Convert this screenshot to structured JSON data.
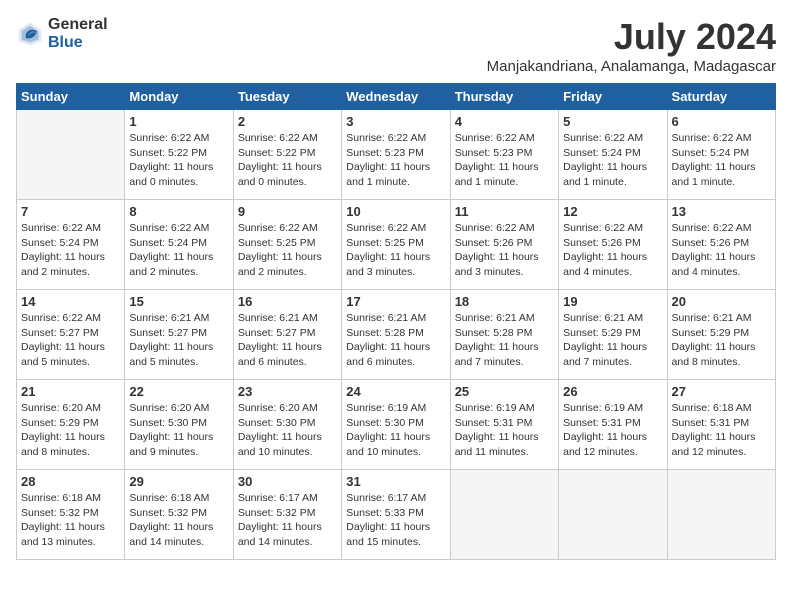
{
  "header": {
    "logo_general": "General",
    "logo_blue": "Blue",
    "month": "July 2024",
    "location": "Manjakandriana, Analamanga, Madagascar"
  },
  "days_of_week": [
    "Sunday",
    "Monday",
    "Tuesday",
    "Wednesday",
    "Thursday",
    "Friday",
    "Saturday"
  ],
  "weeks": [
    [
      {
        "day": "",
        "info": ""
      },
      {
        "day": "1",
        "info": "Sunrise: 6:22 AM\nSunset: 5:22 PM\nDaylight: 11 hours\nand 0 minutes."
      },
      {
        "day": "2",
        "info": "Sunrise: 6:22 AM\nSunset: 5:22 PM\nDaylight: 11 hours\nand 0 minutes."
      },
      {
        "day": "3",
        "info": "Sunrise: 6:22 AM\nSunset: 5:23 PM\nDaylight: 11 hours\nand 1 minute."
      },
      {
        "day": "4",
        "info": "Sunrise: 6:22 AM\nSunset: 5:23 PM\nDaylight: 11 hours\nand 1 minute."
      },
      {
        "day": "5",
        "info": "Sunrise: 6:22 AM\nSunset: 5:24 PM\nDaylight: 11 hours\nand 1 minute."
      },
      {
        "day": "6",
        "info": "Sunrise: 6:22 AM\nSunset: 5:24 PM\nDaylight: 11 hours\nand 1 minute."
      }
    ],
    [
      {
        "day": "7",
        "info": "Sunrise: 6:22 AM\nSunset: 5:24 PM\nDaylight: 11 hours\nand 2 minutes."
      },
      {
        "day": "8",
        "info": "Sunrise: 6:22 AM\nSunset: 5:24 PM\nDaylight: 11 hours\nand 2 minutes."
      },
      {
        "day": "9",
        "info": "Sunrise: 6:22 AM\nSunset: 5:25 PM\nDaylight: 11 hours\nand 2 minutes."
      },
      {
        "day": "10",
        "info": "Sunrise: 6:22 AM\nSunset: 5:25 PM\nDaylight: 11 hours\nand 3 minutes."
      },
      {
        "day": "11",
        "info": "Sunrise: 6:22 AM\nSunset: 5:26 PM\nDaylight: 11 hours\nand 3 minutes."
      },
      {
        "day": "12",
        "info": "Sunrise: 6:22 AM\nSunset: 5:26 PM\nDaylight: 11 hours\nand 4 minutes."
      },
      {
        "day": "13",
        "info": "Sunrise: 6:22 AM\nSunset: 5:26 PM\nDaylight: 11 hours\nand 4 minutes."
      }
    ],
    [
      {
        "day": "14",
        "info": "Sunrise: 6:22 AM\nSunset: 5:27 PM\nDaylight: 11 hours\nand 5 minutes."
      },
      {
        "day": "15",
        "info": "Sunrise: 6:21 AM\nSunset: 5:27 PM\nDaylight: 11 hours\nand 5 minutes."
      },
      {
        "day": "16",
        "info": "Sunrise: 6:21 AM\nSunset: 5:27 PM\nDaylight: 11 hours\nand 6 minutes."
      },
      {
        "day": "17",
        "info": "Sunrise: 6:21 AM\nSunset: 5:28 PM\nDaylight: 11 hours\nand 6 minutes."
      },
      {
        "day": "18",
        "info": "Sunrise: 6:21 AM\nSunset: 5:28 PM\nDaylight: 11 hours\nand 7 minutes."
      },
      {
        "day": "19",
        "info": "Sunrise: 6:21 AM\nSunset: 5:29 PM\nDaylight: 11 hours\nand 7 minutes."
      },
      {
        "day": "20",
        "info": "Sunrise: 6:21 AM\nSunset: 5:29 PM\nDaylight: 11 hours\nand 8 minutes."
      }
    ],
    [
      {
        "day": "21",
        "info": "Sunrise: 6:20 AM\nSunset: 5:29 PM\nDaylight: 11 hours\nand 8 minutes."
      },
      {
        "day": "22",
        "info": "Sunrise: 6:20 AM\nSunset: 5:30 PM\nDaylight: 11 hours\nand 9 minutes."
      },
      {
        "day": "23",
        "info": "Sunrise: 6:20 AM\nSunset: 5:30 PM\nDaylight: 11 hours\nand 10 minutes."
      },
      {
        "day": "24",
        "info": "Sunrise: 6:19 AM\nSunset: 5:30 PM\nDaylight: 11 hours\nand 10 minutes."
      },
      {
        "day": "25",
        "info": "Sunrise: 6:19 AM\nSunset: 5:31 PM\nDaylight: 11 hours\nand 11 minutes."
      },
      {
        "day": "26",
        "info": "Sunrise: 6:19 AM\nSunset: 5:31 PM\nDaylight: 11 hours\nand 12 minutes."
      },
      {
        "day": "27",
        "info": "Sunrise: 6:18 AM\nSunset: 5:31 PM\nDaylight: 11 hours\nand 12 minutes."
      }
    ],
    [
      {
        "day": "28",
        "info": "Sunrise: 6:18 AM\nSunset: 5:32 PM\nDaylight: 11 hours\nand 13 minutes."
      },
      {
        "day": "29",
        "info": "Sunrise: 6:18 AM\nSunset: 5:32 PM\nDaylight: 11 hours\nand 14 minutes."
      },
      {
        "day": "30",
        "info": "Sunrise: 6:17 AM\nSunset: 5:32 PM\nDaylight: 11 hours\nand 14 minutes."
      },
      {
        "day": "31",
        "info": "Sunrise: 6:17 AM\nSunset: 5:33 PM\nDaylight: 11 hours\nand 15 minutes."
      },
      {
        "day": "",
        "info": ""
      },
      {
        "day": "",
        "info": ""
      },
      {
        "day": "",
        "info": ""
      }
    ]
  ]
}
